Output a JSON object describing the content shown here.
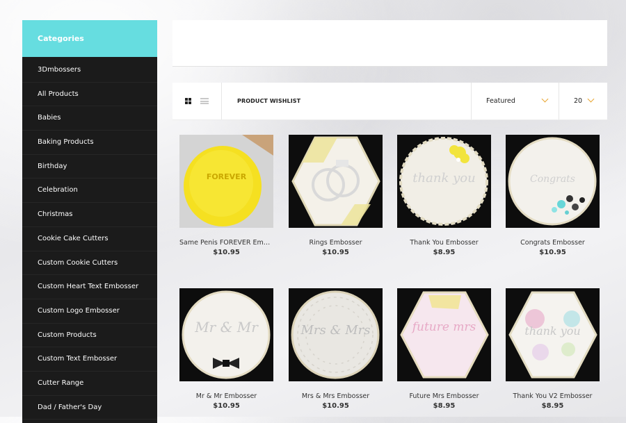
{
  "sidebar": {
    "title": "Categories",
    "items": [
      "3Dmbossers",
      "All Products",
      "Babies",
      "Baking Products",
      "Birthday",
      "Celebration",
      "Christmas",
      "Cookie Cake Cutters",
      "Custom Cookie Cutters",
      "Custom Heart Text Embosser",
      "Custom Logo Embosser",
      "Custom Products",
      "Custom Text Embosser",
      "Cutter Range",
      "Dad / Father's Day"
    ]
  },
  "toolbar": {
    "grid_icon": "grid-view-icon",
    "list_icon": "list-view-icon",
    "wishlist_label": "PRODUCT WISHLIST",
    "sort_value": "Featured",
    "per_page_value": "20",
    "accent_color": "#e8a530"
  },
  "products": [
    {
      "name": "Same Penis FOREVER Embo...",
      "price": "$10.95",
      "image_text": "FOREVER"
    },
    {
      "name": "Rings Embosser",
      "price": "$10.95",
      "image_text": ""
    },
    {
      "name": "Thank You Embosser",
      "price": "$8.95",
      "image_text": "thank you"
    },
    {
      "name": "Congrats Embosser",
      "price": "$10.95",
      "image_text": "Congrats"
    },
    {
      "name": "Mr & Mr Embosser",
      "price": "$10.95",
      "image_text": "Mr & Mr"
    },
    {
      "name": "Mrs & Mrs Embosser",
      "price": "$10.95",
      "image_text": "Mrs & Mrs"
    },
    {
      "name": "Future Mrs Embosser",
      "price": "$8.95",
      "image_text": "future mrs"
    },
    {
      "name": "Thank You V2 Embosser",
      "price": "$8.95",
      "image_text": "thank you"
    }
  ],
  "colors": {
    "sidebar_header": "#66dde0",
    "sidebar_bg": "#1b1b1b"
  }
}
